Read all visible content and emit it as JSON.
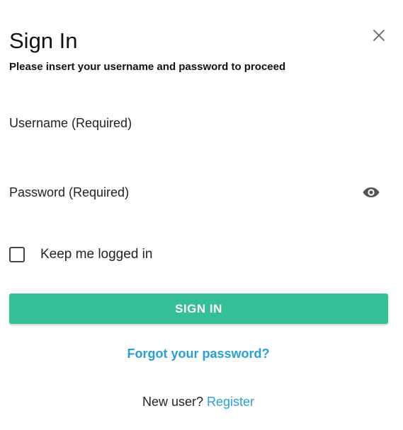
{
  "dialog": {
    "title": "Sign In",
    "subtitle": "Please insert your username and password to proceed",
    "close_icon": "close-icon"
  },
  "form": {
    "username": {
      "placeholder": "Username (Required)",
      "value": ""
    },
    "password": {
      "placeholder": "Password (Required)",
      "value": "",
      "toggle_icon": "eye-icon"
    },
    "remember_me": {
      "label": "Keep me logged in",
      "checked": false
    },
    "submit_label": "SIGN IN"
  },
  "links": {
    "forgot_password": "Forgot your password?",
    "new_user_prompt": "New user?",
    "register": "Register"
  },
  "colors": {
    "primary_button": "#35bf94",
    "link": "#2a9fd2",
    "text": "#1a1a1a"
  }
}
